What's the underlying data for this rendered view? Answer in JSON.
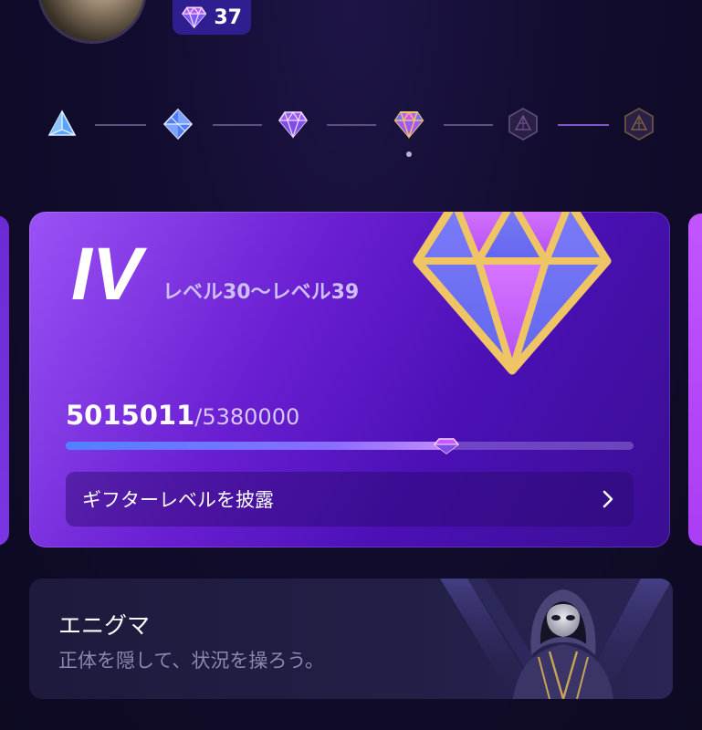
{
  "header": {
    "gem_count": "37"
  },
  "level_track": {
    "tiers": [
      {
        "name": "tier-1-icon",
        "state": "achieved"
      },
      {
        "name": "tier-2-icon",
        "state": "achieved"
      },
      {
        "name": "tier-3-icon",
        "state": "achieved"
      },
      {
        "name": "tier-4-icon",
        "state": "current"
      },
      {
        "name": "tier-5-icon",
        "state": "locked"
      },
      {
        "name": "tier-6-icon",
        "state": "locked"
      }
    ]
  },
  "card": {
    "level": "IV",
    "level_range": "レベル30〜レベル39",
    "points_current": "5015011",
    "points_separator": "/",
    "points_target": "5380000",
    "progress_fraction": 0.6708,
    "reveal_label": "ギフターレベルを披露"
  },
  "enigma": {
    "title": "エニグマ",
    "subtitle": "正体を隠して、状況を操ろう。"
  },
  "colors": {
    "background": "#0f0a26",
    "card_purple": "#6a1fd2",
    "gold": "#e8c062",
    "diamond_pink": "#c55bff",
    "diamond_blue": "#6a73f5"
  }
}
